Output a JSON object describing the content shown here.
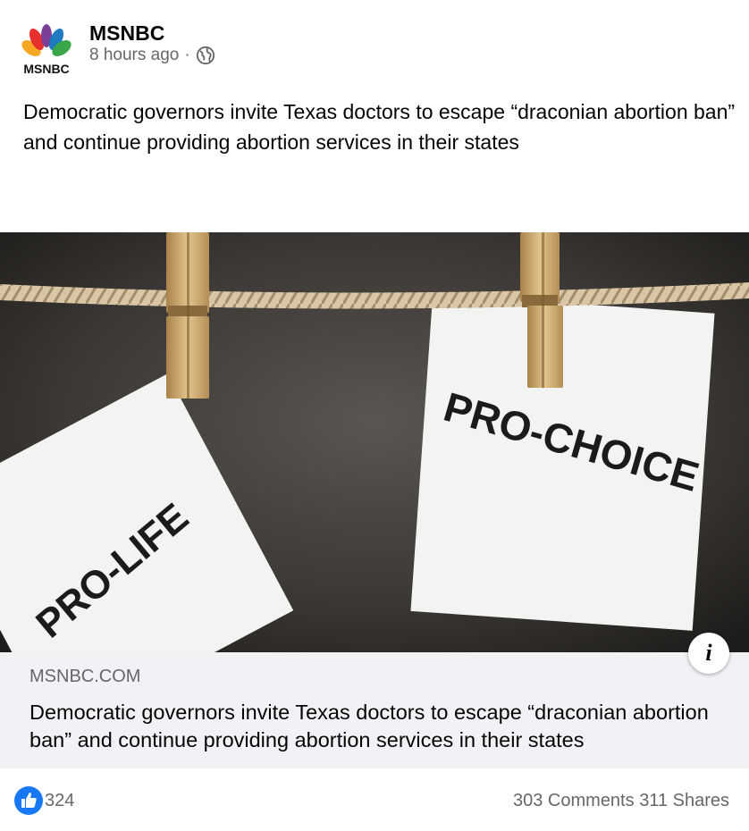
{
  "page": {
    "name": "MSNBC",
    "timestamp": "8 hours ago",
    "separator": "·",
    "audience_icon": "globe-icon",
    "logo_text": "MSNBC"
  },
  "post": {
    "text": "Democratic governors invite Texas doctors to escape “draconian abortion ban” and continue providing abortion services in their states"
  },
  "image": {
    "sign_left": "PRO-LIFE",
    "sign_right": "PRO-CHOICE",
    "info_label": "i"
  },
  "link_preview": {
    "domain": "MSNBC.COM",
    "title": "Democratic governors invite Texas doctors to escape “draconian abortion ban” and continue providing abortion services in their states"
  },
  "stats": {
    "likes": "324",
    "comments": "303 Comments",
    "shares": "311 Shares"
  },
  "colors": {
    "like_blue": "#1877f2",
    "secondary_text": "#65676b",
    "link_bg": "#f0f2f5"
  }
}
